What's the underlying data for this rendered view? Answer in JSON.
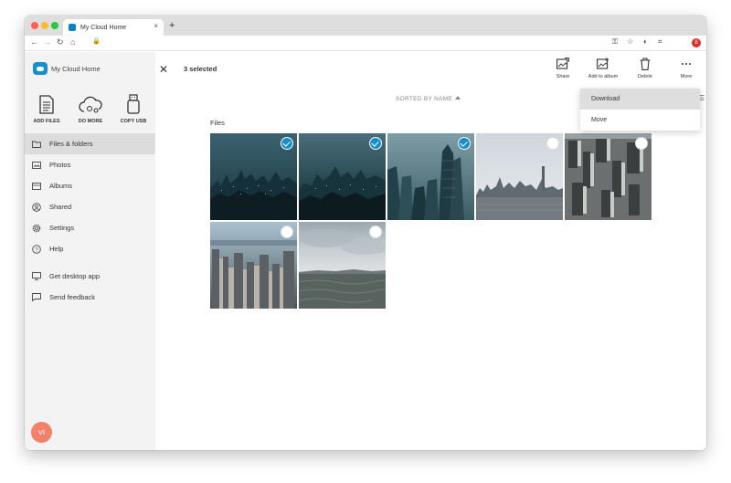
{
  "browser": {
    "tab_title": "My Cloud Home",
    "tab_close": "×",
    "new_tab": "+",
    "profile_badge": "8"
  },
  "app": {
    "logo_text": "My Cloud Home",
    "quick_actions": [
      {
        "label": "ADD FILES",
        "icon": "document-icon"
      },
      {
        "label": "DO MORE",
        "icon": "cloud-icon"
      },
      {
        "label": "COPY USB",
        "icon": "usb-icon"
      }
    ],
    "nav": [
      {
        "label": "Files & folders",
        "icon": "folder-icon",
        "active": true
      },
      {
        "label": "Photos",
        "icon": "photo-icon"
      },
      {
        "label": "Albums",
        "icon": "album-icon"
      },
      {
        "label": "Shared",
        "icon": "shared-icon"
      },
      {
        "label": "Settings",
        "icon": "gear-icon"
      },
      {
        "label": "Help",
        "icon": "help-icon"
      },
      {
        "label": "Get desktop app",
        "icon": "monitor-icon"
      },
      {
        "label": "Send feedback",
        "icon": "feedback-icon"
      }
    ],
    "avatar_initials": "VI"
  },
  "toolbar": {
    "selected_count": "3 selected",
    "actions": [
      {
        "label": "Share",
        "icon": "share-icon"
      },
      {
        "label": "Add to album",
        "icon": "add-to-album-icon"
      },
      {
        "label": "Delete",
        "icon": "trash-icon"
      },
      {
        "label": "More",
        "icon": "more-icon"
      }
    ]
  },
  "sort": {
    "label": "SORTED BY NAME"
  },
  "section": {
    "label": "Files"
  },
  "photos": [
    {
      "selected": true
    },
    {
      "selected": true
    },
    {
      "selected": true
    },
    {
      "selected": false
    },
    {
      "selected": false
    },
    {
      "selected": false
    },
    {
      "selected": false
    }
  ],
  "more_menu": {
    "items": [
      "Download",
      "Move"
    ]
  },
  "colors": {
    "accent": "#1a8ecb",
    "avatar": "#f0826a"
  }
}
